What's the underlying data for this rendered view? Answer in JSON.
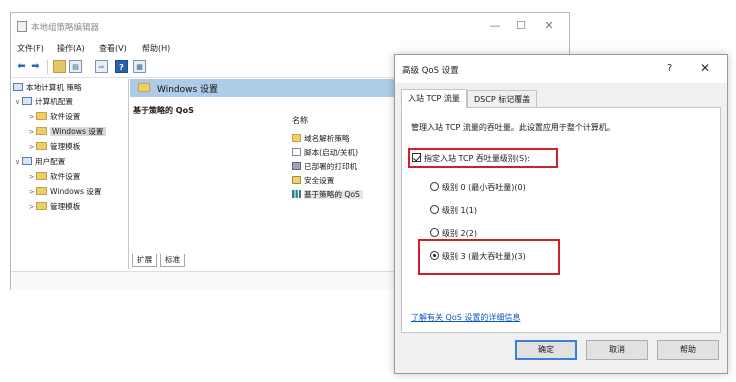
{
  "main_window": {
    "title": "本地组策略编辑器",
    "controls": {
      "minimize": "—",
      "maximize": "☐",
      "close": "✕"
    },
    "menu": [
      "文件(F)",
      "操作(A)",
      "查看(V)",
      "帮助(H)"
    ],
    "toolbar_icons": [
      "back-arrow-icon",
      "forward-arrow-icon",
      "up-folder-icon",
      "show-hide-tree-icon",
      "export-list-icon",
      "help-icon",
      "properties-view-icon"
    ],
    "tree": [
      {
        "label": "本地计算机 策略",
        "icon": "computer-policy-icon",
        "expander": ""
      },
      {
        "label": "计算机配置",
        "icon": "computer-icon",
        "expander": "∨"
      },
      {
        "label": "软件设置",
        "icon": "folder-icon",
        "expander": ">"
      },
      {
        "label": "Windows 设置",
        "icon": "folder-icon",
        "expander": ">",
        "selected": true
      },
      {
        "label": "管理模板",
        "icon": "folder-icon",
        "expander": ">"
      },
      {
        "label": "用户配置",
        "icon": "user-icon",
        "expander": "∨"
      },
      {
        "label": "软件设置",
        "icon": "folder-icon",
        "expander": ">"
      },
      {
        "label": "Windows 设置",
        "icon": "folder-icon",
        "expander": ">"
      },
      {
        "label": "管理模板",
        "icon": "folder-icon",
        "expander": ">"
      }
    ],
    "content_header": "Windows 设置",
    "selected_item_title": "基于策略的 QoS",
    "column_header": "名称",
    "items": [
      {
        "label": "域名解析策略",
        "icon": "folder-icon"
      },
      {
        "label": "脚本(启动/关机)",
        "icon": "script-icon"
      },
      {
        "label": "已部署的打印机",
        "icon": "printer-icon"
      },
      {
        "label": "安全设置",
        "icon": "security-icon"
      },
      {
        "label": "基于策略的 QoS",
        "icon": "qos-chart-icon",
        "highlighted": true
      }
    ],
    "bottom_tabs": [
      "扩展",
      "标准"
    ]
  },
  "dialog": {
    "title": "高级 QoS 设置",
    "help_glyph": "?",
    "close_glyph": "✕",
    "tabs": [
      "入站 TCP 流量",
      "DSCP 标记覆盖"
    ],
    "description": "管理入站 TCP 流量的吞吐量。此设置应用于整个计算机。",
    "checkbox_label": "指定入站 TCP 吞吐量级别(S):",
    "checkbox_checked": true,
    "options": [
      {
        "label": "级别 0 (最小吞吐量)(0)",
        "selected": false
      },
      {
        "label": "级别 1(1)",
        "selected": false
      },
      {
        "label": "级别 2(2)",
        "selected": false
      },
      {
        "label": "级别 3 (最大吞吐量)(3)",
        "selected": true
      }
    ],
    "link_text": "了解有关 QoS 设置的详细信息",
    "buttons": {
      "ok": "确定",
      "cancel": "取消",
      "help": "帮助"
    },
    "highlight_color": "#d21f2b"
  }
}
